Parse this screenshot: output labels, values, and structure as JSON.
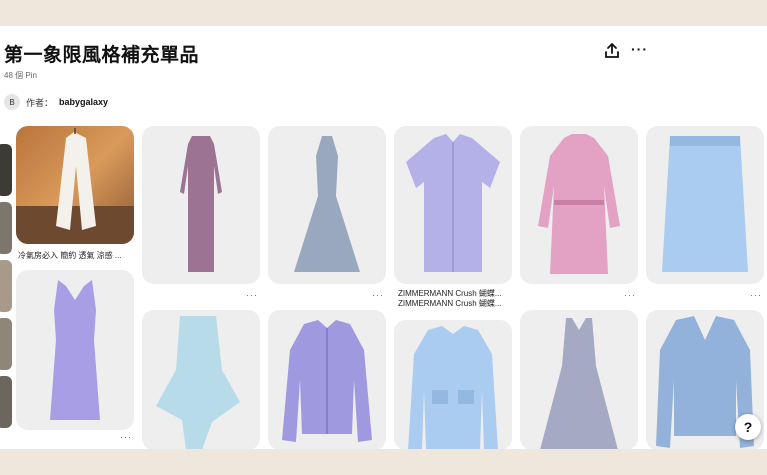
{
  "board": {
    "title": "第一象限風格補充單品",
    "pin_count": "48 個 Pin",
    "author_initial": "B",
    "author_prefix": "作者：",
    "author_name": "babygalaxy"
  },
  "icons": {
    "share": "share-icon",
    "more": "more-options-icon",
    "help": "help-icon"
  },
  "pins": [
    {
      "caption": "冷氣房必入 簡約 透氣 涼感 ...",
      "more": "···"
    },
    {
      "caption": "",
      "more": "···"
    },
    {
      "caption": "",
      "more": "···"
    },
    {
      "caption": "",
      "more": "···"
    },
    {
      "caption": "ZIMMERMANN Crush 蝴蝶...",
      "caption2": "ZIMMERMANN Crush 蝴蝶...",
      "more": "···"
    },
    {
      "caption": "",
      "more": "···"
    },
    {
      "caption": "",
      "more": "···"
    }
  ],
  "help_label": "?",
  "colors": {
    "background_band": "#efe7dc",
    "page": "#ffffff",
    "card_bg": "#eeeeee",
    "lavender": "#a79ee6",
    "light_blue": "#a9ccf0",
    "pink": "#e3a1c4",
    "mauve": "#9c7392",
    "slate_blue": "#9aa8bf"
  }
}
